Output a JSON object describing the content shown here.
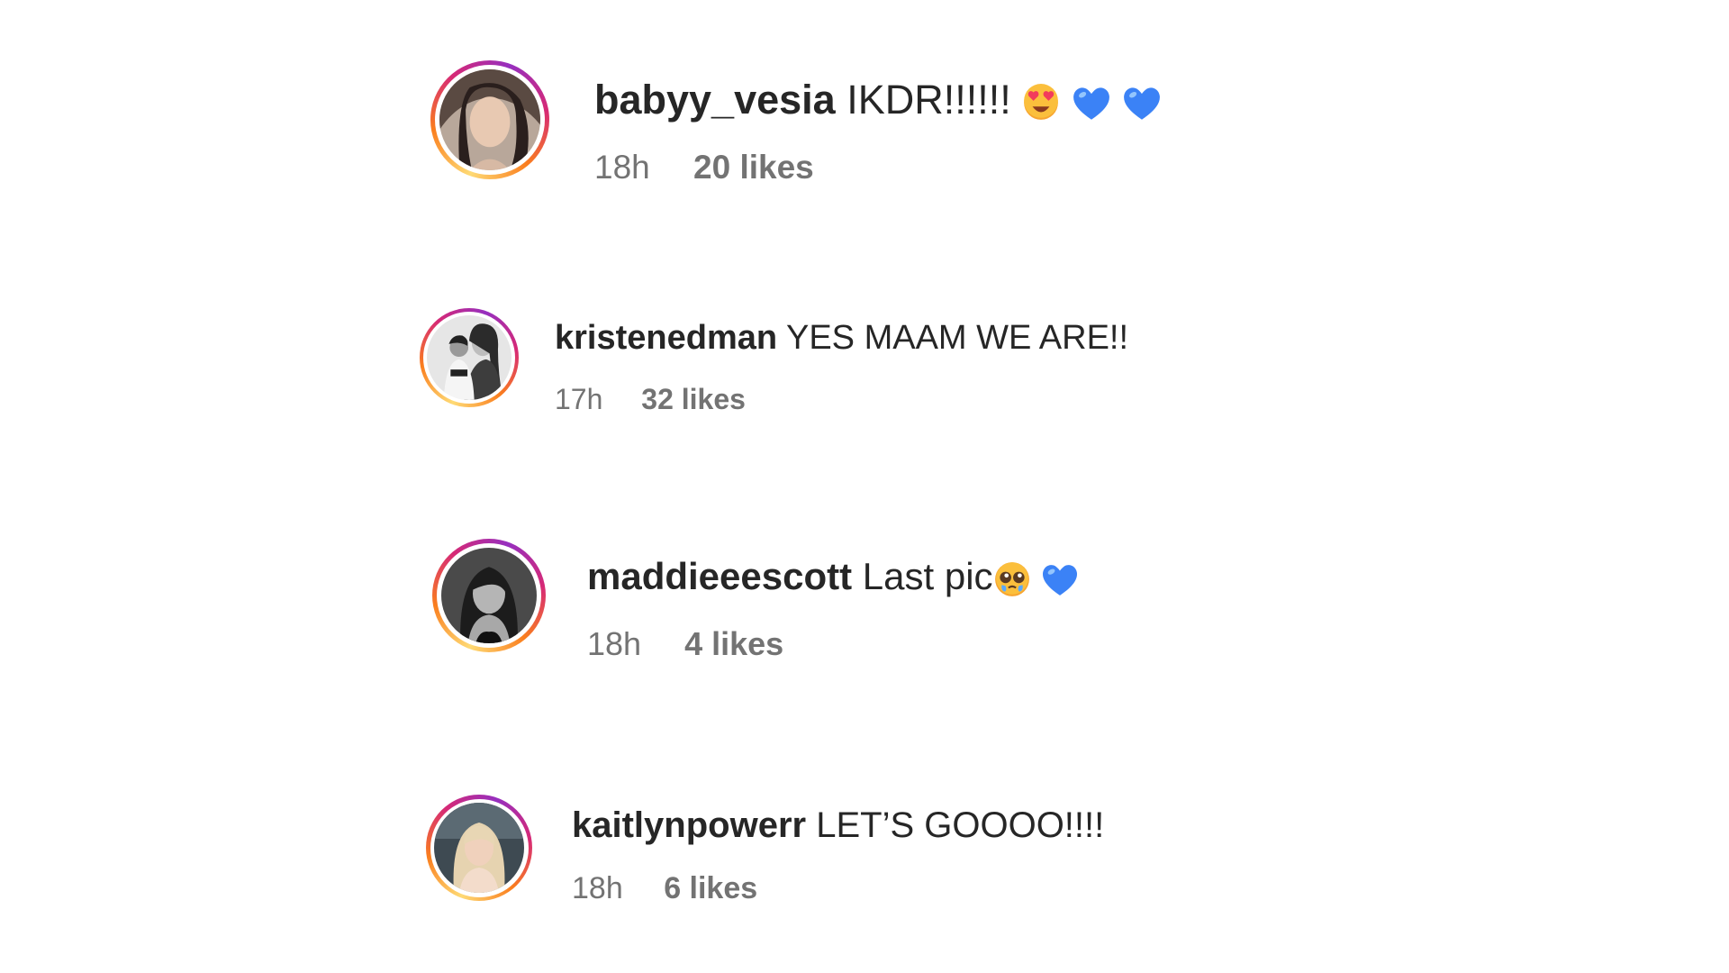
{
  "comments": [
    {
      "username": "babyy_vesia",
      "text": "IKDR!!!!!!",
      "emoji": [
        "star-struck-emoji",
        "blue-heart-emoji",
        "blue-heart-emoji"
      ],
      "time": "18h",
      "likes": "20 likes",
      "avatar": "profile-photo"
    },
    {
      "username": "kristenedman",
      "text": "YES MAAM WE ARE!!",
      "emoji": [],
      "time": "17h",
      "likes": "32 likes",
      "avatar": "profile-photo-bw"
    },
    {
      "username": "maddieeescott",
      "text": "Last pic",
      "emoji": [
        "pleading-face-emoji",
        "blue-heart-emoji"
      ],
      "time": "18h",
      "likes": "4 likes",
      "avatar": "profile-photo-bw"
    },
    {
      "username": "kaitlynpowerr",
      "text": "LET’S GOOOO!!!!",
      "emoji": [],
      "time": "18h",
      "likes": "6 likes",
      "avatar": "profile-photo"
    }
  ],
  "colors": {
    "text": "#262626",
    "meta": "#737373",
    "story_ring_start": "#feda75",
    "story_ring_end": "#d62976",
    "blue_heart": "#3b82f6"
  }
}
